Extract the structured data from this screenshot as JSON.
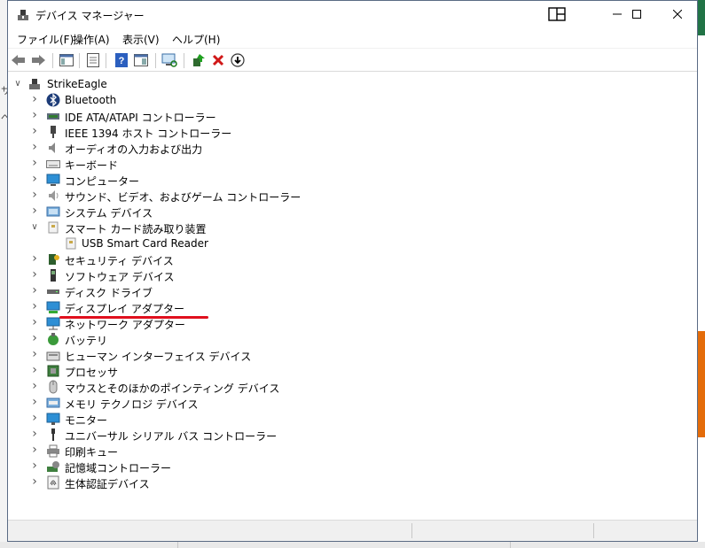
{
  "window": {
    "title": "デバイス マネージャー"
  },
  "menu": [
    "ファイル(F)",
    "操作(A)",
    "表示(V)",
    "ヘルプ(H)"
  ],
  "toolbar": {
    "tools": [
      "back-icon",
      "forward-icon",
      "show-hide-console-tree-icon",
      "properties-icon",
      "help-icon",
      "view-icon",
      "scan-hardware-icon",
      "update-driver-icon",
      "uninstall-icon",
      "disable-icon"
    ]
  },
  "tree": {
    "root": "StrikeEagle",
    "items": [
      {
        "label": "Bluetooth",
        "icon": "bluetooth-icon",
        "expanded": false
      },
      {
        "label": "IDE ATA/ATAPI コントローラー",
        "icon": "ide-controller-icon",
        "expanded": false
      },
      {
        "label": "IEEE 1394 ホスト コントローラー",
        "icon": "ieee1394-icon",
        "expanded": false
      },
      {
        "label": "オーディオの入力および出力",
        "icon": "audio-icon",
        "expanded": false
      },
      {
        "label": "キーボード",
        "icon": "keyboard-icon",
        "expanded": false
      },
      {
        "label": "コンピューター",
        "icon": "computer-icon",
        "expanded": false
      },
      {
        "label": "サウンド、ビデオ、およびゲーム コントローラー",
        "icon": "sound-icon",
        "expanded": false
      },
      {
        "label": "システム デバイス",
        "icon": "system-device-icon",
        "expanded": false
      },
      {
        "label": "スマート カード読み取り装置",
        "icon": "smart-card-reader-icon",
        "expanded": true,
        "children": [
          {
            "label": "USB Smart Card Reader",
            "icon": "smart-card-reader-icon"
          }
        ]
      },
      {
        "label": "セキュリティ デバイス",
        "icon": "security-device-icon",
        "expanded": false
      },
      {
        "label": "ソフトウェア デバイス",
        "icon": "software-device-icon",
        "expanded": false
      },
      {
        "label": "ディスク ドライブ",
        "icon": "disk-drive-icon",
        "expanded": false
      },
      {
        "label": "ディスプレイ アダプター",
        "icon": "display-adapter-icon",
        "expanded": false
      },
      {
        "label": "ネットワーク アダプター",
        "icon": "network-adapter-icon",
        "expanded": false
      },
      {
        "label": "バッテリ",
        "icon": "battery-icon",
        "expanded": false
      },
      {
        "label": "ヒューマン インターフェイス デバイス",
        "icon": "hid-icon",
        "expanded": false
      },
      {
        "label": "プロセッサ",
        "icon": "processor-icon",
        "expanded": false
      },
      {
        "label": "マウスとそのほかのポインティング デバイス",
        "icon": "mouse-icon",
        "expanded": false
      },
      {
        "label": "メモリ テクノロジ デバイス",
        "icon": "memory-icon",
        "expanded": false
      },
      {
        "label": "モニター",
        "icon": "monitor-icon",
        "expanded": false
      },
      {
        "label": "ユニバーサル シリアル バス コントローラー",
        "icon": "usb-icon",
        "expanded": false
      },
      {
        "label": "印刷キュー",
        "icon": "printer-icon",
        "expanded": false
      },
      {
        "label": "記憶域コントローラー",
        "icon": "storage-controller-icon",
        "expanded": false
      },
      {
        "label": "生体認証デバイス",
        "icon": "biometric-icon",
        "expanded": false
      }
    ]
  },
  "colors": {
    "highlight_underline": "#e0101e",
    "window_border": "#5a6b84"
  }
}
